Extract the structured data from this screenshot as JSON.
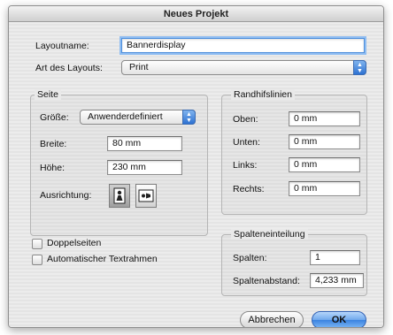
{
  "window": {
    "title": "Neues Projekt"
  },
  "layoutname": {
    "label": "Layoutname:",
    "value": "Bannerdisplay"
  },
  "layout_type": {
    "label": "Art des Layouts:",
    "value": "Print"
  },
  "seite": {
    "title": "Seite",
    "groesse_label": "Größe:",
    "groesse_value": "Anwenderdefiniert",
    "breite_label": "Breite:",
    "breite_value": "80 mm",
    "hoehe_label": "Höhe:",
    "hoehe_value": "230 mm",
    "ausrichtung_label": "Ausrichtung:",
    "ausrichtung_selected": "portrait"
  },
  "randhilfslinien": {
    "title": "Randhifslinien",
    "oben_label": "Oben:",
    "oben_value": "0 mm",
    "unten_label": "Unten:",
    "unten_value": "0 mm",
    "links_label": "Links:",
    "links_value": "0 mm",
    "rechts_label": "Rechts:",
    "rechts_value": "0 mm"
  },
  "options": {
    "doppelseiten_label": "Doppelseiten",
    "doppelseiten_checked": false,
    "auto_text_label": "Automatischer Textrahmen",
    "auto_text_checked": false
  },
  "spalteneinteilung": {
    "title": "Spalteneinteilung",
    "spalten_label": "Spalten:",
    "spalten_value": "1",
    "abstand_label": "Spaltenabstand:",
    "abstand_value": "4,233 mm"
  },
  "buttons": {
    "cancel_label": "Abbrechen",
    "ok_label": "OK"
  },
  "icons": {
    "popup_arrows": "updown-arrows-icon",
    "portrait": "portrait-orientation-icon",
    "landscape": "landscape-orientation-icon"
  },
  "colors": {
    "focus_ring": "#8fbdf2",
    "default_button": "#3b83e0",
    "window_bg": "#e9e9e9"
  }
}
